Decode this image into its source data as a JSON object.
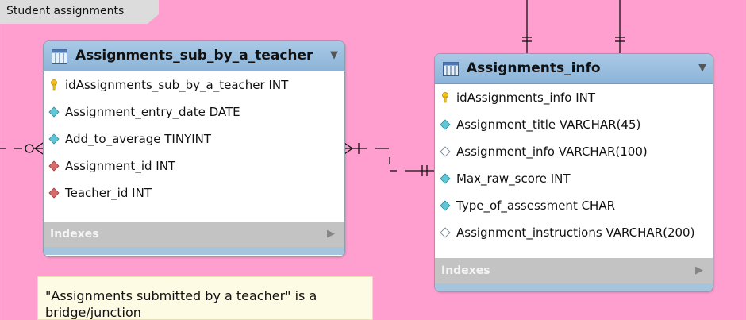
{
  "layer": {
    "title": "Student assignments"
  },
  "tables": [
    {
      "name": "Assignments_sub_by_a_teacher",
      "columns": [
        {
          "kind": "primary-key",
          "text": "idAssignments_sub_by_a_teacher INT"
        },
        {
          "kind": "not-null",
          "text": "Assignment_entry_date DATE"
        },
        {
          "kind": "not-null",
          "text": "Add_to_average TINYINT"
        },
        {
          "kind": "foreign-key",
          "text": "Assignment_id INT"
        },
        {
          "kind": "foreign-key",
          "text": "Teacher_id INT"
        }
      ],
      "indexes_label": "Indexes"
    },
    {
      "name": "Assignments_info",
      "columns": [
        {
          "kind": "primary-key",
          "text": "idAssignments_info INT"
        },
        {
          "kind": "not-null",
          "text": "Assignment_title VARCHAR(45)"
        },
        {
          "kind": "nullable",
          "text": "Assignment_info VARCHAR(100)"
        },
        {
          "kind": "not-null",
          "text": "Max_raw_score INT"
        },
        {
          "kind": "not-null",
          "text": "Type_of_assessment CHAR"
        },
        {
          "kind": "nullable",
          "text": "Assignment_instructions VARCHAR(200)"
        }
      ],
      "indexes_label": "Indexes"
    }
  ],
  "note": {
    "text": "\"Assignments submitted by a teacher\" is a bridge/junction"
  },
  "colors": {
    "canvas": "#ff9fcf",
    "table_header": "#9ec0e0",
    "indexes_bar": "#c3c3c3",
    "note_bg": "#fefbe5",
    "not_null_icon": "#5fc8d8",
    "foreign_key_icon": "#d86a6a",
    "nullable_icon": "#ffffff",
    "primary_key_icon": "#f2c21a"
  }
}
